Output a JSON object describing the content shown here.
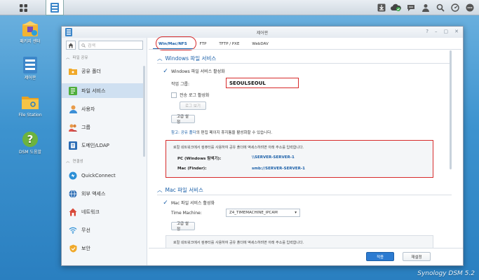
{
  "window": {
    "title": "제어판",
    "controls": [
      "?",
      "–",
      "▢",
      "✕"
    ]
  },
  "desktop": {
    "icons": [
      {
        "label": "패키지 센터"
      },
      {
        "label": "제어판"
      },
      {
        "label": "File Station"
      },
      {
        "label": "DSM 도움말"
      }
    ]
  },
  "sidebar": {
    "search_placeholder": "검색",
    "section_file_sharing": "파일 공유",
    "section_connectivity": "연결성",
    "items": [
      {
        "label": "공유 폴더"
      },
      {
        "label": "파일 서비스"
      },
      {
        "label": "사용자"
      },
      {
        "label": "그룹"
      },
      {
        "label": "도메인/LDAP"
      },
      {
        "label": "QuickConnect"
      },
      {
        "label": "외부 액세스"
      },
      {
        "label": "네트워크"
      },
      {
        "label": "무선"
      },
      {
        "label": "보안"
      }
    ]
  },
  "tabs": [
    {
      "label": "Win/Mac/NFS"
    },
    {
      "label": "FTP"
    },
    {
      "label": "TFTP / PXE"
    },
    {
      "label": "WebDAV"
    }
  ],
  "windows_section": {
    "title": "Windows 파일 서비스",
    "enable_label": "Windows 파일 서비스 활성화",
    "workgroup_label": "작업 그룹:",
    "workgroup_value": "SEOULSEOUL",
    "transfer_log_label": "전송 로그 활성화",
    "view_log_button": "로그 보기",
    "advanced_button": "고급 설정",
    "note_prefix": "참고: ",
    "note_link": "공유 폴더",
    "note_suffix": "의 편집 페이지 휴지통을 활성화할 수 있습니다.",
    "info_text": "로컬 네트워크에서 컴퓨터를 사용하여 공유 폴더에 액세스하려면 아래 주소를 입력합니다.",
    "pc_key": "PC (Windows 탐색기):",
    "pc_value": "\\\\SERVER-SERVER-1",
    "mac_key": "Mac (Finder):",
    "mac_value": "smb://SERVER-SERVER-1"
  },
  "mac_section": {
    "title": "Mac 파일 서비스",
    "enable_label": "Mac 파일 서비스 활성화",
    "time_machine_label": "Time Machine:",
    "time_machine_value": "Z4_TIMEMACHINE_IPCAM",
    "advanced_button": "고급 설정",
    "info_text": "로컬 네트워크에서 컴퓨터를 사용하여 공유 폴더에 액세스하려면 아래 주소를 입력합니다."
  },
  "footer": {
    "apply_button": "적용",
    "reset_button": "재설정"
  },
  "brand": "Synology DSM 5.2",
  "colors": {
    "accent": "#1a5fa8",
    "highlight": "#d72b2b",
    "apply": "#2c7bd1"
  }
}
